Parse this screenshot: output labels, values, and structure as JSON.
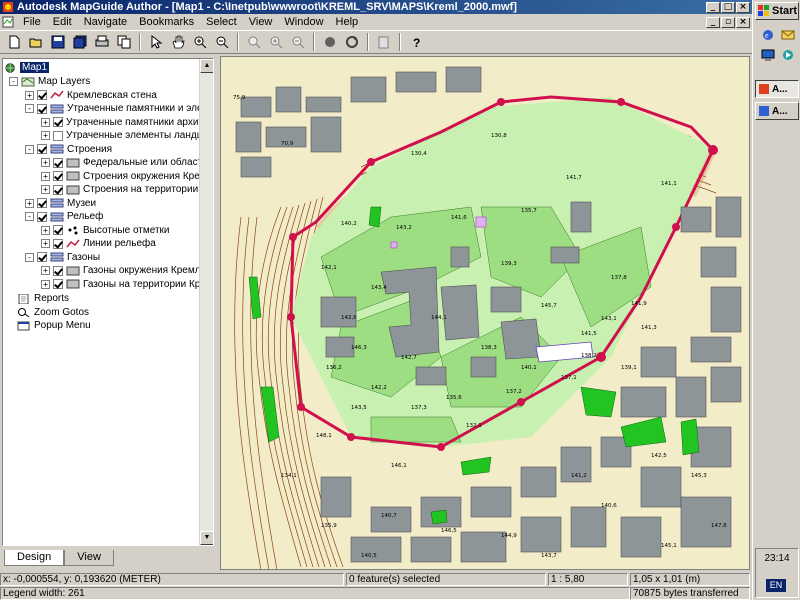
{
  "window": {
    "title": "Autodesk MapGuide Author - [Map1 - C:\\Inetpub\\wwwroot\\KREML_SRV\\MAPS\\Kreml_2000.mwf]",
    "controls": [
      "minimize",
      "maximize",
      "close"
    ]
  },
  "menu": [
    "File",
    "Edit",
    "Navigate",
    "Bookmarks",
    "Select",
    "View",
    "Window",
    "Help"
  ],
  "toolbar": {
    "buttons": [
      "new-icon",
      "open-icon",
      "save-icon",
      "save-all-icon",
      "print-icon",
      "copy-icon",
      "select-arrow-icon",
      "pan-hand-icon",
      "zoom-in-icon",
      "zoom-out-icon",
      "zoom-previous-icon",
      "zoom-in-grey-icon",
      "zoom-out-grey-icon",
      "stop-icon",
      "refresh-icon",
      "copy-map-icon",
      "help-icon"
    ]
  },
  "layer_tree": {
    "root": "Map1",
    "items": [
      {
        "label": "Map Layers",
        "level": 0,
        "expand": "-",
        "checked": null,
        "icon": "layers-icon"
      },
      {
        "label": "Кремлевская стена",
        "level": 1,
        "expand": "+",
        "checked": true,
        "icon": "line-layer-icon"
      },
      {
        "label": "Утраченные памятники и элементы",
        "level": 1,
        "expand": "-",
        "checked": true,
        "icon": "group-icon"
      },
      {
        "label": "Утраченные памятники архитек",
        "level": 2,
        "expand": "+",
        "checked": true,
        "icon": "none"
      },
      {
        "label": "Утраченные элементы ландшаф",
        "level": 2,
        "expand": "+",
        "checked": false,
        "icon": "none"
      },
      {
        "label": "Строения",
        "level": 1,
        "expand": "-",
        "checked": true,
        "icon": "group-icon"
      },
      {
        "label": "Федеральные или областные",
        "level": 2,
        "expand": "+",
        "checked": true,
        "icon": "area-layer-icon"
      },
      {
        "label": "Строения окружения Кремля",
        "level": 2,
        "expand": "+",
        "checked": true,
        "icon": "area-layer-icon"
      },
      {
        "label": "Строения на территории Кремля",
        "level": 2,
        "expand": "+",
        "checked": true,
        "icon": "area-layer-icon"
      },
      {
        "label": "Музеи",
        "level": 1,
        "expand": "+",
        "checked": true,
        "icon": "group-icon"
      },
      {
        "label": "Рельеф",
        "level": 1,
        "expand": "-",
        "checked": true,
        "icon": "group-icon"
      },
      {
        "label": "Высотные отметки",
        "level": 2,
        "expand": "+",
        "checked": true,
        "icon": "point-layer-icon"
      },
      {
        "label": "Линии рельефа",
        "level": 2,
        "expand": "+",
        "checked": true,
        "icon": "line-layer-icon"
      },
      {
        "label": "Газоны",
        "level": 1,
        "expand": "-",
        "checked": true,
        "icon": "group-icon"
      },
      {
        "label": "Газоны окружения Кремля",
        "level": 2,
        "expand": "+",
        "checked": true,
        "icon": "area-layer-icon"
      },
      {
        "label": "Газоны на территории Кремля",
        "level": 2,
        "expand": "+",
        "checked": true,
        "icon": "area-layer-icon"
      }
    ],
    "extras": [
      {
        "label": "Reports",
        "icon": "reports-icon"
      },
      {
        "label": "Zoom Gotos",
        "icon": "zoom-gotos-icon"
      },
      {
        "label": "Popup Menu",
        "icon": "popup-menu-icon"
      }
    ]
  },
  "tabs": [
    {
      "label": "Design",
      "active": true
    },
    {
      "label": "View",
      "active": false
    }
  ],
  "map": {
    "spot_heights": [
      "75,9",
      "70,9",
      "130,4",
      "130,8",
      "141,1",
      "140,2",
      "143,2",
      "141,6",
      "135,7",
      "141,7",
      "142,1",
      "143,4",
      "139,3",
      "137,8",
      "141,9",
      "142,6",
      "144,1",
      "145,7",
      "141,5",
      "143,1",
      "146,3",
      "142,7",
      "138,3",
      "140,1",
      "137,1",
      "142,2",
      "135,6",
      "137,2",
      "138,2",
      "139,1",
      "141,3",
      "143,5",
      "137,3",
      "132,1",
      "136,2",
      "134,1",
      "140,7",
      "141,2",
      "140,6",
      "142,5",
      "145,3",
      "147,6",
      "146,5",
      "135,9",
      "140,5",
      "143,7",
      "144,9",
      "145,1",
      "146,1",
      "148,1"
    ],
    "colors": {
      "background": "#f3ecc8",
      "contours": "#8b4513",
      "wall": "#d0104c",
      "lawn_inside": "#9ede82",
      "lawn_outside": "#22c422",
      "buildings": "#8e9599",
      "monuments": "#b060d0"
    }
  },
  "status": {
    "coords": "x: -0,000554, y: 0,193620 (METER)",
    "selected": "0 feature(s) selected",
    "scale": "1 : 5,80",
    "size": "1,05 x 1,01 (m)",
    "legend_width": "Legend width: 261",
    "transferred": "70875 bytes transferred"
  },
  "taskbar": {
    "start": "Start",
    "tasks": [
      "A...",
      "A..."
    ],
    "clock": "23:14",
    "lang": "EN"
  }
}
